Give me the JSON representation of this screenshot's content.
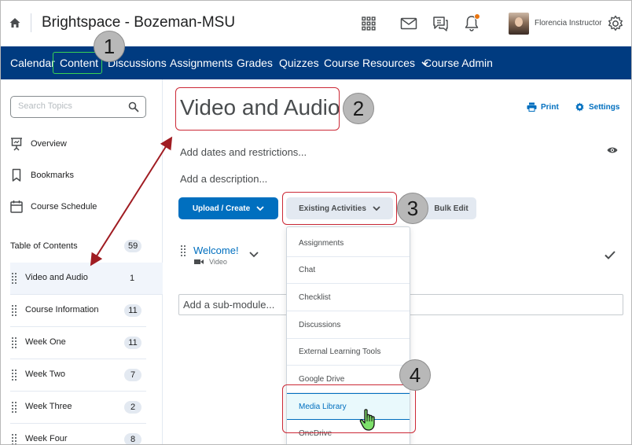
{
  "header": {
    "org_title": "Brightspace - Bozeman-MSU",
    "user_name": "Florencia Instructor"
  },
  "navbar": {
    "items": [
      "Calendar",
      "Content",
      "Discussions",
      "Assignments",
      "Grades",
      "Quizzes",
      "Course Resources",
      "Course Admin"
    ]
  },
  "sidebar": {
    "search_placeholder": "Search Topics",
    "links": [
      "Overview",
      "Bookmarks",
      "Course Schedule"
    ],
    "toc_label": "Table of Contents",
    "toc_count": "59",
    "modules": [
      {
        "label": "Video and Audio",
        "count": "1"
      },
      {
        "label": "Course Information",
        "count": "11"
      },
      {
        "label": "Week One",
        "count": "11"
      },
      {
        "label": "Week Two",
        "count": "7"
      },
      {
        "label": "Week Three",
        "count": "2"
      },
      {
        "label": "Week Four",
        "count": "8"
      }
    ]
  },
  "main": {
    "title": "Video and Audio",
    "print_label": "Print",
    "settings_label": "Settings",
    "dates_label": "Add dates and restrictions...",
    "description_label": "Add a description...",
    "upload_label": "Upload / Create",
    "existing_label": "Existing Activities",
    "bulk_edit_label": "Bulk Edit",
    "topic_title": "Welcome!",
    "topic_type": "Video",
    "submodule_label": "Add a sub-module..."
  },
  "dropdown": {
    "items": [
      "Assignments",
      "Chat",
      "Checklist",
      "Discussions",
      "External Learning Tools",
      "Google Drive",
      "Media Library",
      "OneDrive"
    ]
  },
  "callouts": [
    "1",
    "2",
    "3",
    "4"
  ],
  "colors": {
    "nav_bg": "#003b80",
    "primary": "#006fbf",
    "highlight_red": "#cc2936",
    "highlight_green": "#39d353"
  }
}
